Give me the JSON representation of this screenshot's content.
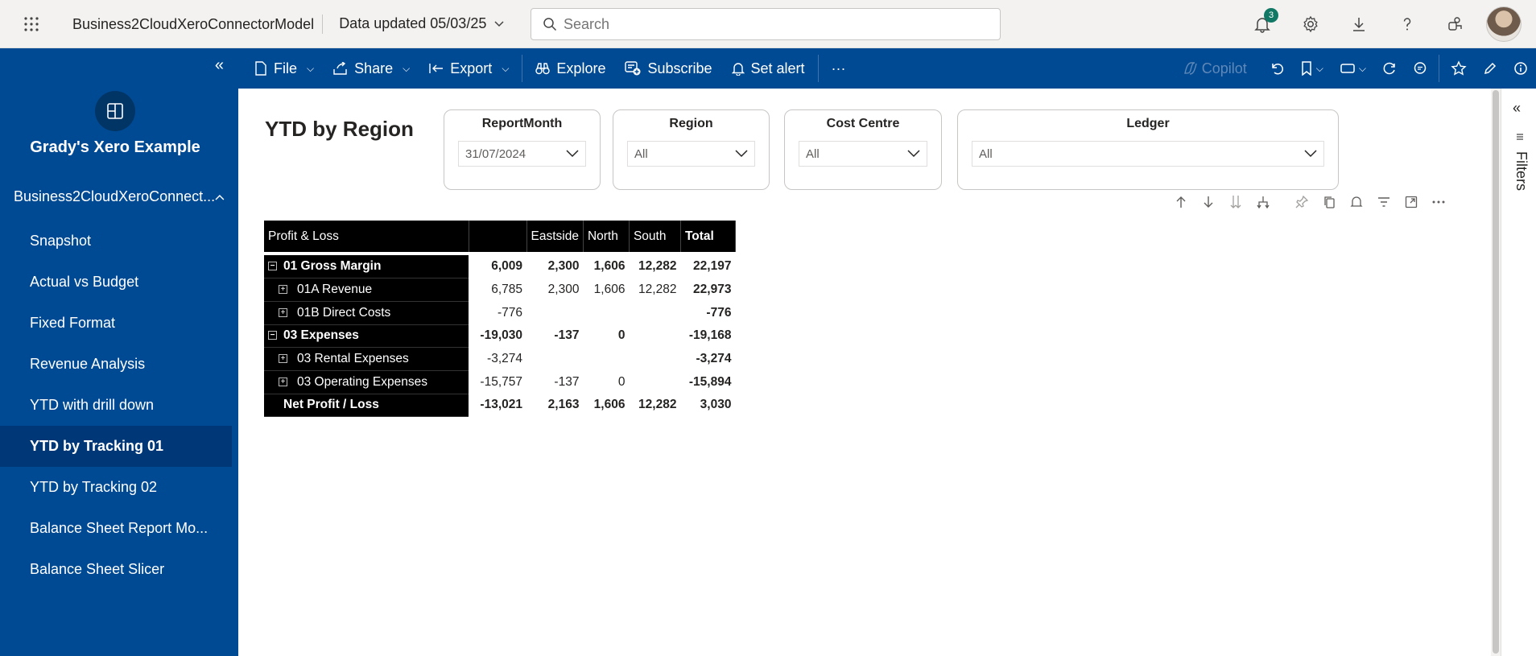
{
  "topbar": {
    "app_title": "Business2CloudXeroConnectorModel",
    "updated": "Data updated 05/03/25",
    "search_placeholder": "Search",
    "notification_count": "3"
  },
  "sidebar": {
    "workspace_name": "Grady's Xero Example",
    "model_name": "Business2CloudXeroConnect...",
    "items": [
      {
        "label": "Snapshot"
      },
      {
        "label": "Actual vs Budget"
      },
      {
        "label": "Fixed Format"
      },
      {
        "label": "Revenue Analysis"
      },
      {
        "label": "YTD with drill down"
      },
      {
        "label": "YTD by Tracking 01"
      },
      {
        "label": "YTD by Tracking 02"
      },
      {
        "label": "Balance Sheet Report Mo..."
      },
      {
        "label": "Balance Sheet Slicer"
      }
    ],
    "active_index": 5
  },
  "toolbar": {
    "file": "File",
    "share": "Share",
    "export": "Export",
    "explore": "Explore",
    "subscribe": "Subscribe",
    "set_alert": "Set alert",
    "more": "···",
    "copilot": "Copilot"
  },
  "filters_pane": {
    "label": "Filters"
  },
  "page": {
    "title": "YTD by Region",
    "slicers": [
      {
        "title": "ReportMonth",
        "value": "31/07/2024"
      },
      {
        "title": "Region",
        "value": "All"
      },
      {
        "title": "Cost Centre",
        "value": "All"
      },
      {
        "title": "Ledger",
        "value": "All"
      }
    ]
  },
  "matrix": {
    "corner": "Profit & Loss",
    "columns": [
      "",
      "Eastside",
      "North",
      "South",
      "Total"
    ],
    "rows": [
      {
        "label": "01 Gross Margin",
        "level": 0,
        "expand": "⊟",
        "bold": true,
        "values": [
          "6,009",
          "2,300",
          "1,606",
          "12,282",
          "22,197"
        ]
      },
      {
        "label": "01A Revenue",
        "level": 1,
        "expand": "⊞",
        "bold": false,
        "values": [
          "6,785",
          "2,300",
          "1,606",
          "12,282",
          "22,973"
        ]
      },
      {
        "label": "01B Direct Costs",
        "level": 1,
        "expand": "⊞",
        "bold": false,
        "values": [
          "-776",
          "",
          "",
          "",
          "-776"
        ]
      },
      {
        "label": "03 Expenses",
        "level": 0,
        "expand": "⊟",
        "bold": true,
        "values": [
          "-19,030",
          "-137",
          "0",
          "",
          "-19,168"
        ]
      },
      {
        "label": "03 Rental Expenses",
        "level": 1,
        "expand": "⊞",
        "bold": false,
        "values": [
          "-3,274",
          "",
          "",
          "",
          "-3,274"
        ]
      },
      {
        "label": "03 Operating Expenses",
        "level": 1,
        "expand": "⊞",
        "bold": false,
        "values": [
          "-15,757",
          "-137",
          "0",
          "",
          "-15,894"
        ]
      },
      {
        "label": "Net Profit / Loss",
        "level": 0,
        "expand": "",
        "bold": true,
        "values": [
          "-13,021",
          "2,163",
          "1,606",
          "12,282",
          "3,030"
        ]
      }
    ]
  }
}
